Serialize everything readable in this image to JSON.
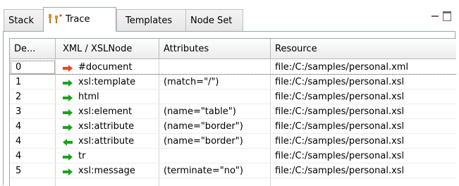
{
  "tabs": [
    {
      "label": "Stack"
    },
    {
      "label": "Trace"
    },
    {
      "label": "Templates"
    },
    {
      "label": "Node Set"
    }
  ],
  "table": {
    "columns": [
      "De...",
      "XML / XSLNode",
      "Attributes",
      "Resource"
    ],
    "rows": [
      {
        "depth": "0",
        "direction": "in-active",
        "node": "#document",
        "attributes": "",
        "resource": "file:/C:/samples/personal.xml"
      },
      {
        "depth": "1",
        "direction": "in",
        "node": "xsl:template",
        "attributes": "(match=\"/\")",
        "resource": "file:/C:/samples/personal.xsl"
      },
      {
        "depth": "2",
        "direction": "in",
        "node": "html",
        "attributes": "",
        "resource": "file:/C:/samples/personal.xsl"
      },
      {
        "depth": "3",
        "direction": "in",
        "node": "xsl:element",
        "attributes": "(name=\"table\")",
        "resource": "file:/C:/samples/personal.xsl"
      },
      {
        "depth": "4",
        "direction": "in",
        "node": "xsl:attribute",
        "attributes": "(name=\"border\")",
        "resource": "file:/C:/samples/personal.xsl"
      },
      {
        "depth": "4",
        "direction": "out",
        "node": "xsl:attribute",
        "attributes": "(name=\"border\")",
        "resource": "file:/C:/samples/personal.xsl"
      },
      {
        "depth": "4",
        "direction": "in",
        "node": "tr",
        "attributes": "",
        "resource": "file:/C:/samples/personal.xsl"
      },
      {
        "depth": "5",
        "direction": "in",
        "node": "xsl:message",
        "attributes": "(terminate=\"no\")",
        "resource": "file:/C:/samples/personal.xsl"
      }
    ]
  },
  "colors": {
    "arrow_green": "#1aa31a",
    "arrow_red": "#e8461e",
    "frame": "#9aa6b8"
  },
  "icons": {
    "trace_tab": "trace-icon",
    "minimize": "minimize-icon",
    "maximize": "maximize-icon"
  }
}
